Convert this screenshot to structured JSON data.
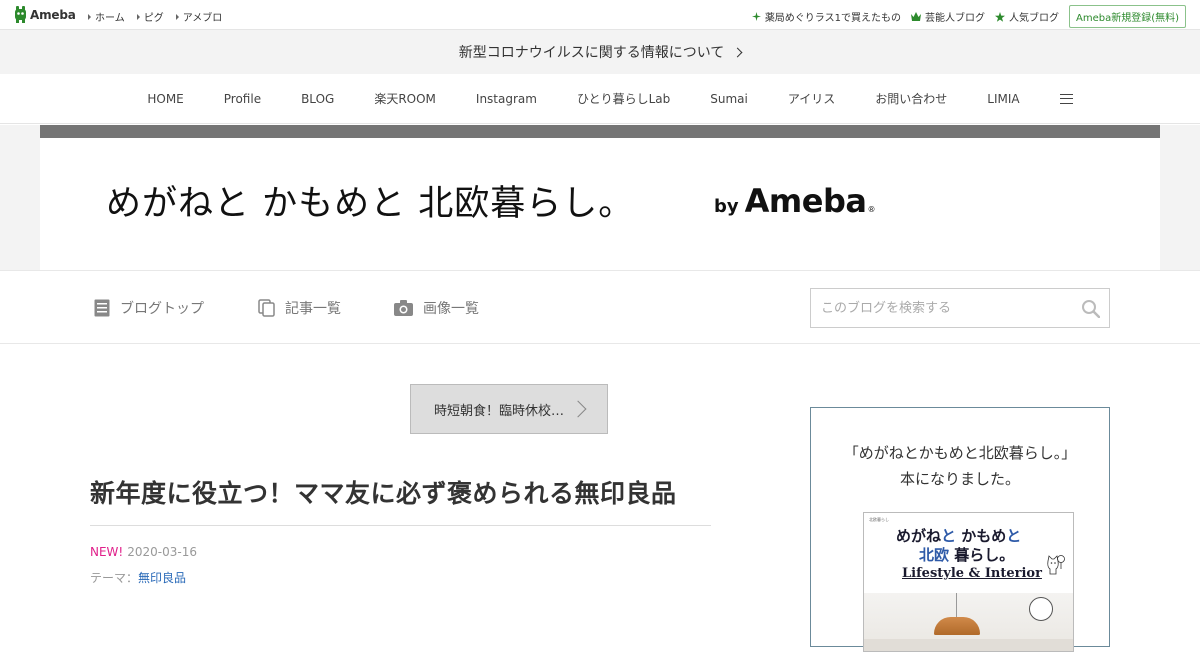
{
  "topbar": {
    "logo_text": "Ameba",
    "links": [
      "ホーム",
      "ピグ",
      "アメブロ"
    ],
    "right_links": [
      {
        "icon": "sparkle-icon",
        "label": "薬局めぐりラス1で買えたもの"
      },
      {
        "icon": "crown-icon",
        "label": "芸能人ブログ"
      },
      {
        "icon": "star-icon",
        "label": "人気ブログ"
      }
    ],
    "signup_label": "Ameba新規登録(無料)"
  },
  "announcement": {
    "text": "新型コロナウイルスに関する情報について"
  },
  "blog_nav": {
    "items": [
      "HOME",
      "Profile",
      "BLOG",
      "楽天ROOM",
      "Instagram",
      "ひとり暮らしLab",
      "Sumai",
      "アイリス",
      "お問い合わせ",
      "LIMIA"
    ]
  },
  "header": {
    "title": "めがねと かもめと 北欧暮らし。",
    "by": "by",
    "ameba": "Ameba",
    "reg": "®"
  },
  "subnav": {
    "items": [
      {
        "icon": "document-icon",
        "label": "ブログトップ"
      },
      {
        "icon": "copy-icon",
        "label": "記事一覧"
      },
      {
        "icon": "camera-icon",
        "label": "画像一覧"
      }
    ],
    "search_placeholder": "このブログを検索する"
  },
  "entry": {
    "prev_label": "時短朝食！臨時休校…",
    "title": "新年度に役立つ！ママ友に必ず褒められる無印良品",
    "new_badge": "NEW!",
    "date": "2020-03-16",
    "theme_prefix": "テーマ：",
    "theme_link": "無印良品"
  },
  "sidebar": {
    "line1": "「めがねとかもめと北欧暮らし。」",
    "line2": "本になりました。",
    "book": {
      "small_text": "北欧暮らし",
      "title_line1_a": "めがね",
      "title_line1_b": "と",
      "title_line1_c": "かもめ",
      "title_line1_d": "と",
      "title_line2_a": "北欧",
      "title_line2_b": "暮らし。",
      "subtitle": "Lifestyle & Interior"
    }
  },
  "colors": {
    "ameba_green": "#2d8a2d",
    "new_badge": "#e0208a",
    "link_blue": "#2a6ab8",
    "header_bar": "#757575"
  }
}
